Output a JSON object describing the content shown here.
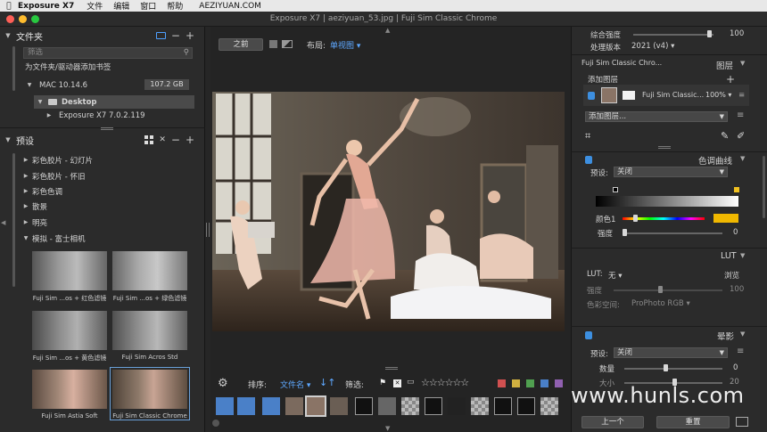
{
  "menubar": {
    "apple": "",
    "app": "Exposure X7",
    "items": [
      "文件",
      "编辑",
      "窗口",
      "帮助"
    ],
    "site": "AEZIYUAN.COM"
  },
  "window": {
    "title": "Exposure X7 | aeziyuan_53.jpg | Fuji Sim Classic Chrome"
  },
  "folders": {
    "title": "文件夹",
    "search_placeholder": "筛选",
    "add_bookmark": "为文件夹/驱动器添加书签",
    "drive": "MAC 10.14.6",
    "drive_size": "107.2 GB",
    "desktop": "Desktop",
    "subfolder": "Exposure X7 7.0.2.119"
  },
  "presets": {
    "title": "预设",
    "groups": [
      "彩色胶片 - 幻灯片",
      "彩色胶片 - 怀旧",
      "彩色色调",
      "散景",
      "明亮",
      "模拟 - 富士相机"
    ],
    "thumbs": [
      "Fuji Sim ...os + 红色滤镜",
      "Fuji Sim ...os + 绿色滤镜",
      "Fuji Sim ...os + 黄色滤镜",
      "Fuji Sim Acros Std",
      "Fuji Sim Astia Soft",
      "Fuji Sim Classic Chrome"
    ]
  },
  "viewer": {
    "before": "之前",
    "layout_label": "布局:",
    "layout_value": "单视图"
  },
  "filmbar": {
    "sort_label": "排序:",
    "sort_value": "文件名",
    "filter_label": "筛选:"
  },
  "right": {
    "overall_strength": "综合强度",
    "overall_value": "100",
    "process_version": "处理版本",
    "process_value": "2021 (v4)",
    "preset_name": "Fuji Sim Classic Chro...",
    "layers": "图层",
    "add_layer": "添加图层",
    "layer_name": "Fuji Sim Classic...",
    "layer_pct": "100%",
    "add_layer_dd": "添加图层...",
    "tone_curve": "色调曲线",
    "preset_label": "预设:",
    "preset_off": "关闭",
    "color1": "颜色1",
    "strength": "强度",
    "strength_value": "0",
    "lut_title": "LUT",
    "lut_label": "LUT:",
    "lut_value": "无",
    "browse": "浏览",
    "lut_strength": "强度",
    "lut_strength_value": "100",
    "color_space_label": "色彩空间:",
    "color_space_value": "ProPhoto RGB",
    "vignette": "晕影",
    "vig_preset_label": "预设:",
    "vig_preset_value": "关闭",
    "amount": "数量",
    "amount_value": "0",
    "size": "大小",
    "size_value": "20",
    "prev_button": "上一个",
    "reset_button": "重置"
  },
  "watermark": "www.hunls.com",
  "colors": {
    "accent": "#3d8fe0",
    "link": "#5ea8ff",
    "panel": "#2b2b2b"
  }
}
